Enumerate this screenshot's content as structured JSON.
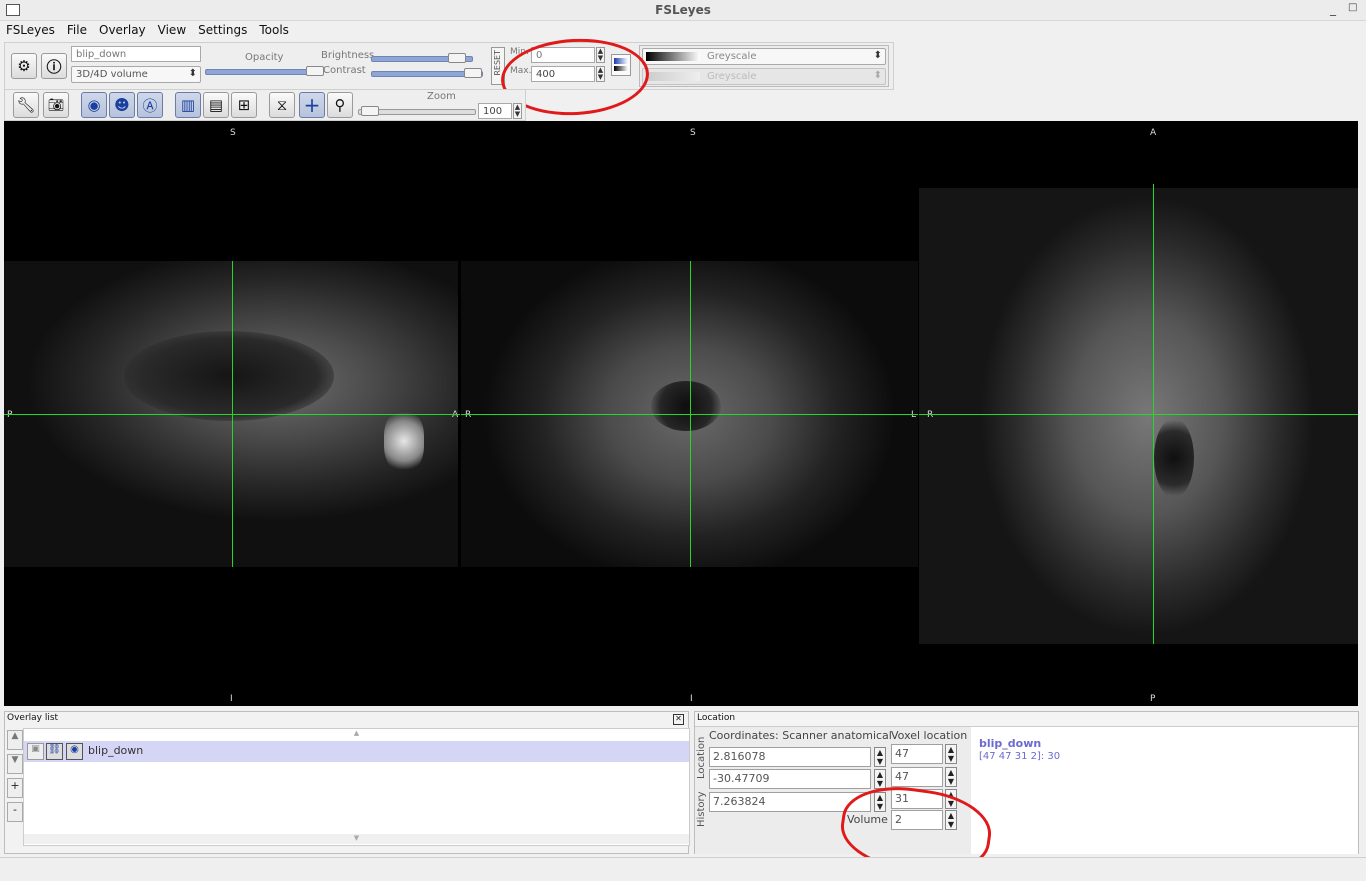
{
  "window": {
    "title": "FSLeyes",
    "minimize": "_",
    "maximize": "□"
  },
  "menu": [
    "FSLeyes",
    "File",
    "Overlay",
    "View",
    "Settings",
    "Tools"
  ],
  "overlay_toolbar": {
    "name_value": "blip_down",
    "type_value": "3D/4D volume",
    "opacity_label": "Opacity",
    "opacity": 1.0,
    "brightness_label": "Brightness",
    "brightness": 0.9,
    "contrast_label": "Contrast",
    "contrast": 0.98,
    "reset_label": "RESET",
    "min_label": "Min.",
    "min_value": "0",
    "max_label": "Max.",
    "max_value": "400",
    "cmap_value": "Greyscale",
    "neg_cmap_value": "Greyscale"
  },
  "ortho_toolbar": {
    "zoom_label": "Zoom",
    "zoom_value": "100",
    "zoom": 0.02
  },
  "views": {
    "sagittal": {
      "top": "S",
      "bottom": "I",
      "left": "P",
      "right": "A"
    },
    "coronal": {
      "top": "S",
      "bottom": "I",
      "left": "R",
      "right": "L"
    },
    "axial": {
      "top": "A",
      "bottom": "P",
      "left": "R",
      "right": ""
    }
  },
  "overlay_list": {
    "title": "Overlay list",
    "items": [
      {
        "name": "blip_down"
      }
    ],
    "up_icon": "▲",
    "down_icon": "▼"
  },
  "location": {
    "title": "Location",
    "tabs": [
      "Location",
      "History"
    ],
    "coords_label": "Coordinates: Scanner anatomical",
    "voxel_label": "Voxel location",
    "coords": [
      "2.816078",
      "-30.47709",
      "7.263824"
    ],
    "voxels": [
      "47",
      "47",
      "31"
    ],
    "volume_label": "Volume",
    "volume_value": "2",
    "info_name": "blip_down",
    "info_value": "[47 47 31 2]: 30"
  },
  "colors": {
    "crosshair": "#23d923",
    "annotation": "#e01919",
    "info_accent": "#6a6ad0"
  },
  "icons": [
    "gear-icon",
    "info-icon",
    "wrench-icon",
    "camera-icon",
    "sagittal-icon",
    "coronal-icon",
    "axial-icon",
    "horizontal-layout-icon",
    "vertical-layout-icon",
    "grid-layout-icon",
    "movie-icon",
    "crosshair-icon",
    "zoom-icon"
  ]
}
